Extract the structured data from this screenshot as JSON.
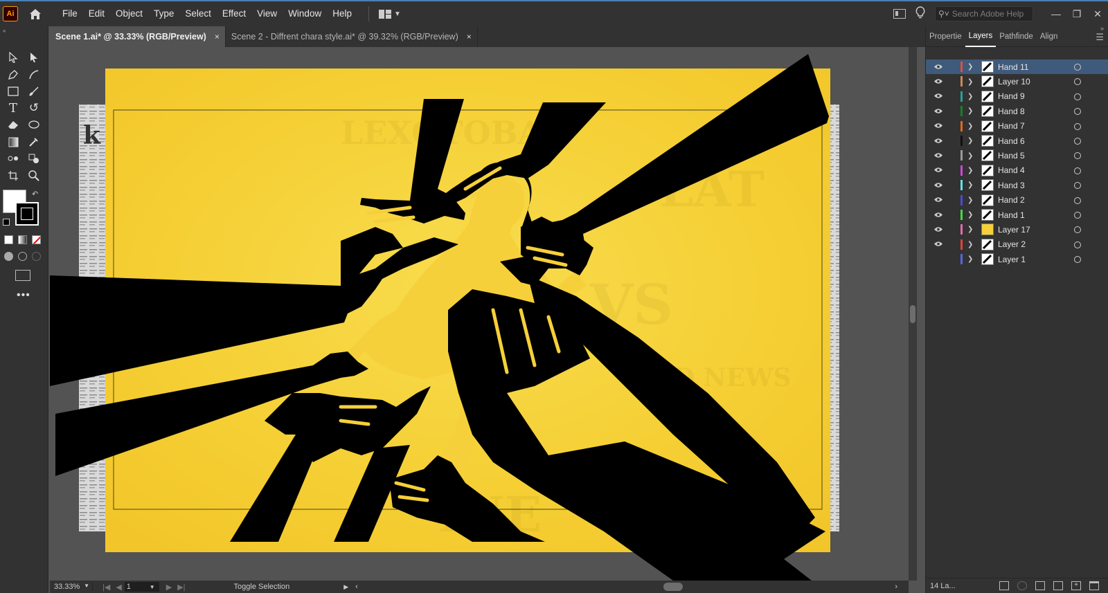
{
  "app": {
    "logo": "Ai"
  },
  "menu": [
    "File",
    "Edit",
    "Object",
    "Type",
    "Select",
    "Effect",
    "View",
    "Window",
    "Help"
  ],
  "search": {
    "placeholder": "Search Adobe Help"
  },
  "tabs": [
    {
      "label": "Scene 1.ai* @ 33.33% (RGB/Preview)",
      "close": "×",
      "active": true
    },
    {
      "label": "Scene 2 - Diffrent chara style.ai* @ 39.32% (RGB/Preview)",
      "close": "×",
      "active": false
    }
  ],
  "panel": {
    "tabs": [
      "Propertie",
      "Layers",
      "Pathfinde",
      "Align"
    ],
    "active_tab": "Layers",
    "layers": [
      {
        "name": "Hand 11",
        "color": "#e14f3f",
        "visible": true,
        "selected": true
      },
      {
        "name": "Layer 10",
        "color": "#c98a53",
        "visible": true
      },
      {
        "name": "Hand 9",
        "color": "#2aa09c",
        "visible": true
      },
      {
        "name": "Hand 8",
        "color": "#1e7d2a",
        "visible": true
      },
      {
        "name": "Hand 7",
        "color": "#e06a1a",
        "visible": true
      },
      {
        "name": "Hand 6",
        "color": "#111111",
        "visible": true
      },
      {
        "name": "Hand 5",
        "color": "#9a9a9a",
        "visible": true
      },
      {
        "name": "Hand 4",
        "color": "#d044d8",
        "visible": true
      },
      {
        "name": "Hand 3",
        "color": "#5fe3ec",
        "visible": true
      },
      {
        "name": "Hand 2",
        "color": "#4a4adc",
        "visible": true
      },
      {
        "name": "Hand 1",
        "color": "#44d944",
        "visible": true
      },
      {
        "name": "Layer 17",
        "color": "#e36ba8",
        "visible": true
      },
      {
        "name": "Layer 2",
        "color": "#e0413a",
        "visible": true
      },
      {
        "name": "Layer 1",
        "color": "#5566e0",
        "visible": false
      }
    ],
    "footer": "14 La..."
  },
  "status": {
    "zoom": "33.33%",
    "page": "1",
    "toggle": "Toggle Selection"
  },
  "colors": {
    "artboard_yellow": "#f6d03a",
    "silhouette": "#000000",
    "accent": "#4a7fb5"
  }
}
